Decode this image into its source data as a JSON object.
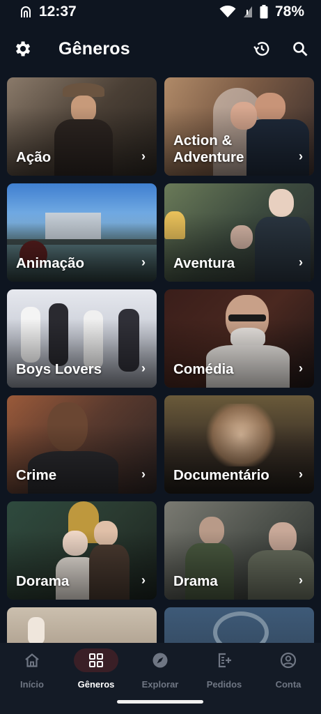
{
  "status": {
    "time": "12:37",
    "battery": "78%"
  },
  "header": {
    "title": "Gêneros"
  },
  "genres": [
    {
      "label": "Ação"
    },
    {
      "label": "Action & Adventure"
    },
    {
      "label": "Animação"
    },
    {
      "label": "Aventura"
    },
    {
      "label": "Boys Lovers"
    },
    {
      "label": "Comédia"
    },
    {
      "label": "Crime"
    },
    {
      "label": "Documentário"
    },
    {
      "label": "Dorama"
    },
    {
      "label": "Drama"
    }
  ],
  "nav": {
    "items": [
      {
        "label": "Início",
        "icon": "home-icon"
      },
      {
        "label": "Gêneros",
        "icon": "grid-icon"
      },
      {
        "label": "Explorar",
        "icon": "compass-icon"
      },
      {
        "label": "Pedidos",
        "icon": "request-icon"
      },
      {
        "label": "Conta",
        "icon": "account-icon"
      }
    ],
    "active": "Gêneros"
  },
  "colors": {
    "background": "#0e1520",
    "nav_background": "#141b26",
    "active_pill": "#3a1f26",
    "inactive": "#6f7683"
  }
}
